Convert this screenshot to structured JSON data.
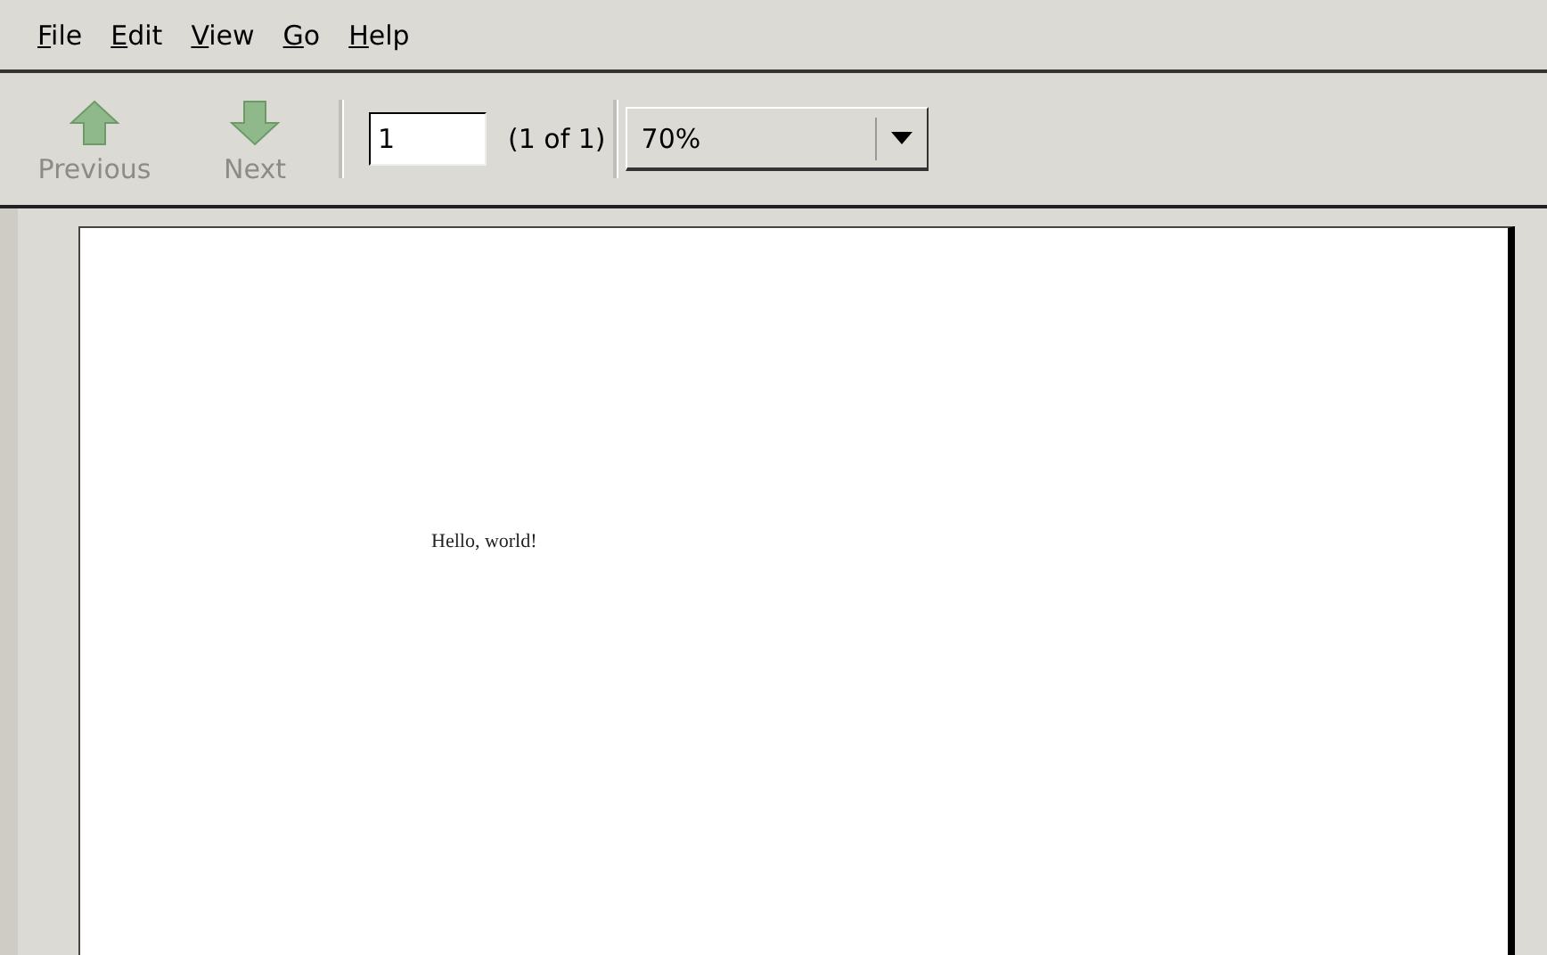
{
  "menu": [
    {
      "label": "File"
    },
    {
      "label": "Edit"
    },
    {
      "label": "View"
    },
    {
      "label": "Go"
    },
    {
      "label": "Help"
    }
  ],
  "toolbar": {
    "buttons": [
      {
        "kind": "up",
        "label": "Previous",
        "disabled": true
      },
      {
        "kind": "down",
        "label": "Next",
        "disabled": true
      }
    ],
    "page_field": {
      "value": "1"
    },
    "page_count": "(1 of 1)",
    "zoom": {
      "value": "70%"
    }
  },
  "document": {
    "text": "Hello, world!"
  }
}
